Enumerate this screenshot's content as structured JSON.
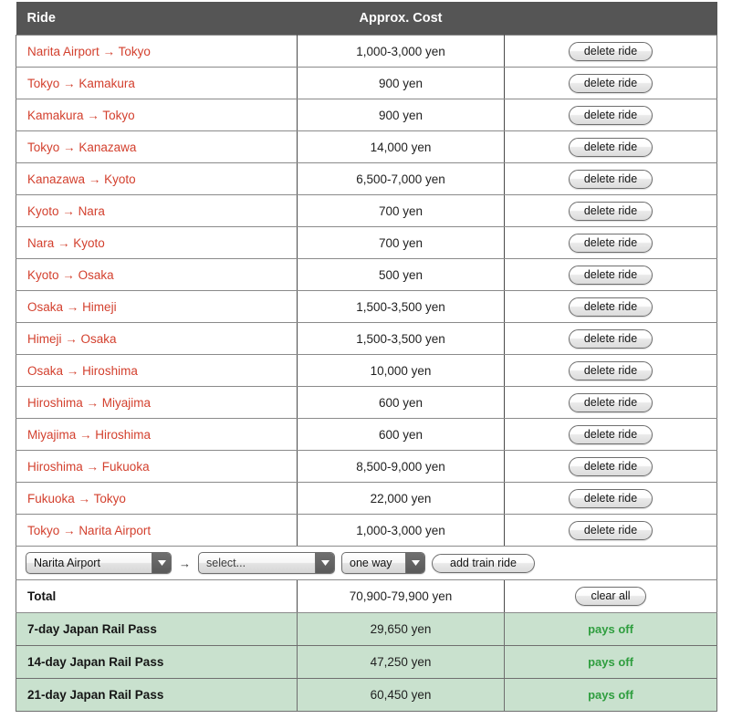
{
  "table": {
    "columns": {
      "ride": "Ride",
      "cost": "Approx. Cost",
      "action": ""
    },
    "delete_label": "delete ride",
    "rows": [
      {
        "from": "Narita Airport",
        "to": "Tokyo",
        "arrow": "→",
        "cost": "1,000-3,000 yen"
      },
      {
        "from": "Tokyo",
        "to": "Kamakura",
        "arrow": "→",
        "cost": "900 yen"
      },
      {
        "from": "Kamakura",
        "to": "Tokyo",
        "arrow": "→",
        "cost": "900 yen"
      },
      {
        "from": "Tokyo",
        "to": "Kanazawa",
        "arrow": "→",
        "cost": "14,000 yen"
      },
      {
        "from": "Kanazawa",
        "to": "Kyoto",
        "arrow": "→",
        "cost": "6,500-7,000 yen"
      },
      {
        "from": "Kyoto",
        "to": "Nara",
        "arrow": "→",
        "cost": "700 yen"
      },
      {
        "from": "Nara",
        "to": "Kyoto",
        "arrow": "→",
        "cost": "700 yen"
      },
      {
        "from": "Kyoto",
        "to": "Osaka",
        "arrow": "→",
        "cost": "500 yen"
      },
      {
        "from": "Osaka",
        "to": "Himeji",
        "arrow": "→",
        "cost": "1,500-3,500 yen"
      },
      {
        "from": "Himeji",
        "to": "Osaka",
        "arrow": "→",
        "cost": "1,500-3,500 yen"
      },
      {
        "from": "Osaka",
        "to": "Hiroshima",
        "arrow": "→",
        "cost": "10,000 yen"
      },
      {
        "from": "Hiroshima",
        "to": "Miyajima",
        "arrow": "→",
        "cost": "600 yen"
      },
      {
        "from": "Miyajima",
        "to": "Hiroshima",
        "arrow": "→",
        "cost": "600 yen"
      },
      {
        "from": "Hiroshima",
        "to": "Fukuoka",
        "arrow": "→",
        "cost": "8,500-9,000 yen"
      },
      {
        "from": "Fukuoka",
        "to": "Tokyo",
        "arrow": "→",
        "cost": "22,000 yen"
      },
      {
        "from": "Tokyo",
        "to": "Narita Airport",
        "arrow": "→",
        "cost": "1,000-3,000 yen"
      }
    ]
  },
  "form": {
    "origin_value": "Narita Airport",
    "separator_arrow": "→",
    "destination_value": "select...",
    "trip_type_value": "one way",
    "add_button_label": "add train ride"
  },
  "total": {
    "label": "Total",
    "cost": "70,900-79,900 yen",
    "clear_button_label": "clear all"
  },
  "passes": [
    {
      "label": "7-day Japan Rail Pass",
      "cost": "29,650 yen",
      "status": "pays off"
    },
    {
      "label": "14-day Japan Rail Pass",
      "cost": "47,250 yen",
      "status": "pays off"
    },
    {
      "label": "21-day Japan Rail Pass",
      "cost": "60,450 yen",
      "status": "pays off"
    }
  ],
  "colors": {
    "header_bg": "#555555",
    "ride_link": "#d3402e",
    "pass_row_bg": "#c9e1ce",
    "pays_off_green": "#2f9e3f"
  }
}
